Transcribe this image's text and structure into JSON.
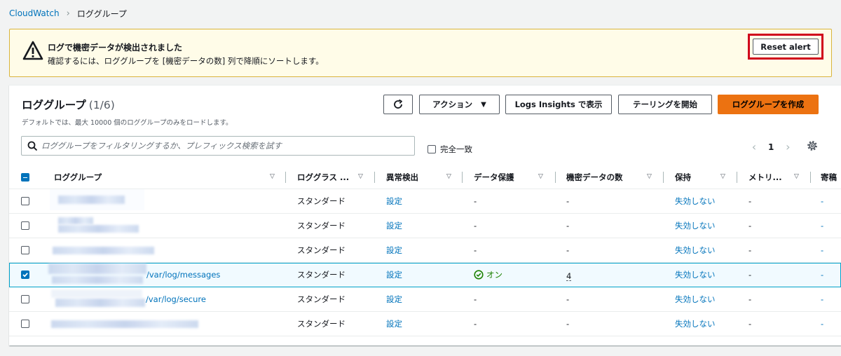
{
  "breadcrumb": {
    "root": "CloudWatch",
    "separator": "›",
    "current": "ロググループ"
  },
  "alert": {
    "title": "ログで機密データが検出されました",
    "description": "確認するには、ロググループを [機密データの数] 列で降順にソートします。",
    "reset_label": "Reset alert",
    "colors": {
      "background": "#fffce8",
      "border": "#d9b43c",
      "highlight": "#d0021b"
    }
  },
  "panel": {
    "title": "ロググループ",
    "count": "(1/6)",
    "subtitle": "デフォルトでは、最大 10000 個のロググループのみをロードします。",
    "actions_label": "アクション",
    "insights_label": "Logs Insights で表示",
    "tail_label": "テーリングを開始",
    "create_label": "ロググループを作成"
  },
  "search": {
    "placeholder": "ロググループをフィルタリングするか、プレフィックス検索を試す",
    "value": ""
  },
  "exact_match_label": "完全一致",
  "pagination": {
    "page": "1"
  },
  "table": {
    "columns": [
      "ロググループ",
      "ロググラス ...",
      "異常検出",
      "データ保護",
      "機密データの数",
      "保持",
      "メトリ...",
      "寄稿"
    ],
    "rows": [
      {
        "name_suffix": "",
        "class": "スタンダード",
        "anomaly": "設定",
        "protection": "-",
        "sensitive": "-",
        "retention": "失効しない",
        "metric": "-",
        "contrib": "-",
        "selected": false
      },
      {
        "name_suffix": "",
        "class": "スタンダード",
        "anomaly": "設定",
        "protection": "-",
        "sensitive": "-",
        "retention": "失効しない",
        "metric": "-",
        "contrib": "-",
        "selected": false
      },
      {
        "name_suffix": "",
        "class": "スタンダード",
        "anomaly": "設定",
        "protection": "-",
        "sensitive": "-",
        "retention": "失効しない",
        "metric": "-",
        "contrib": "-",
        "selected": false
      },
      {
        "name_suffix": "/var/log/messages",
        "class": "スタンダード",
        "anomaly": "設定",
        "protection": "オン",
        "sensitive": "4",
        "retention": "失効しない",
        "metric": "-",
        "contrib": "-",
        "selected": true
      },
      {
        "name_suffix": "/var/log/secure",
        "class": "スタンダード",
        "anomaly": "設定",
        "protection": "-",
        "sensitive": "-",
        "retention": "失効しない",
        "metric": "-",
        "contrib": "-",
        "selected": false
      },
      {
        "name_suffix": "",
        "class": "スタンダード",
        "anomaly": "設定",
        "protection": "-",
        "sensitive": "-",
        "retention": "失効しない",
        "metric": "-",
        "contrib": "-",
        "selected": false
      }
    ]
  },
  "colors": {
    "link": "#0073bb",
    "primary": "#ec7211",
    "success": "#1d8102"
  },
  "icons": [
    "warning-icon",
    "refresh-icon",
    "caret-down-icon",
    "search-icon",
    "chevron-left-icon",
    "chevron-right-icon",
    "gear-icon",
    "sort-icon",
    "check-circle-icon"
  ]
}
